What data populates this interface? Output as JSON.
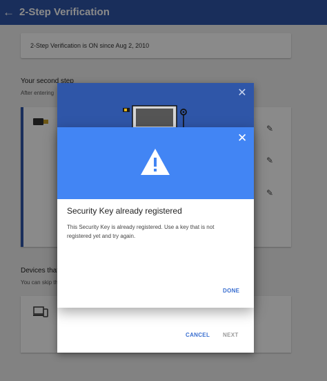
{
  "header": {
    "title": "2-Step Verification",
    "back_icon": "arrow-back-icon"
  },
  "status_card": {
    "text": "2-Step Verification is ON since Aug 2, 2010"
  },
  "second_step": {
    "heading": "Your second step",
    "description": "After entering"
  },
  "devices_section": {
    "heading": "Devices that",
    "description": "You can skip th"
  },
  "outer_dialog": {
    "cancel_label": "CANCEL",
    "next_label": "NEXT"
  },
  "error_dialog": {
    "title": "Security Key already registered",
    "body": "This Security Key is already registered. Use a key that is not registered yet and try again.",
    "done_label": "DONE"
  },
  "colors": {
    "app_bar": "#2f56a8",
    "dialog_header": "#4285f4",
    "action_text": "#3a6fd0",
    "disabled_text": "#9a9a9a"
  }
}
